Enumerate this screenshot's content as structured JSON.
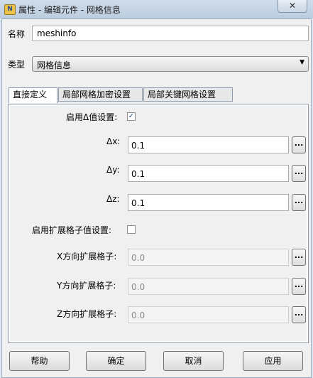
{
  "window": {
    "title": "属性 - 编辑元件 - 网格信息",
    "close_glyph": "✕",
    "icon": "app-icon"
  },
  "name": {
    "label": "名称",
    "value": "meshinfo"
  },
  "type": {
    "label": "类型",
    "selected": "网格信息"
  },
  "tabs": [
    {
      "label": "直接定义",
      "active": true
    },
    {
      "label": "局部网格加密设置",
      "active": false
    },
    {
      "label": "局部关键网格设置",
      "active": false
    }
  ],
  "delta": {
    "enable_label": "启用Δ值设置:",
    "enabled": true,
    "fields": [
      {
        "label": "Δx:",
        "value": "0.1"
      },
      {
        "label": "Δy:",
        "value": "0.1"
      },
      {
        "label": "Δz:",
        "value": "0.1"
      }
    ]
  },
  "expand": {
    "enable_label": "启用扩展格子值设置:",
    "enabled": false,
    "fields": [
      {
        "label": "X方向扩展格子:",
        "value": "0.0"
      },
      {
        "label": "Y方向扩展格子:",
        "value": "0.0"
      },
      {
        "label": "Z方向扩展格子:",
        "value": "0.0"
      }
    ]
  },
  "browse_label": "...",
  "checkmark": "✓",
  "buttons": {
    "help": "帮助",
    "ok": "确定",
    "cancel": "取消",
    "apply": "应用"
  }
}
